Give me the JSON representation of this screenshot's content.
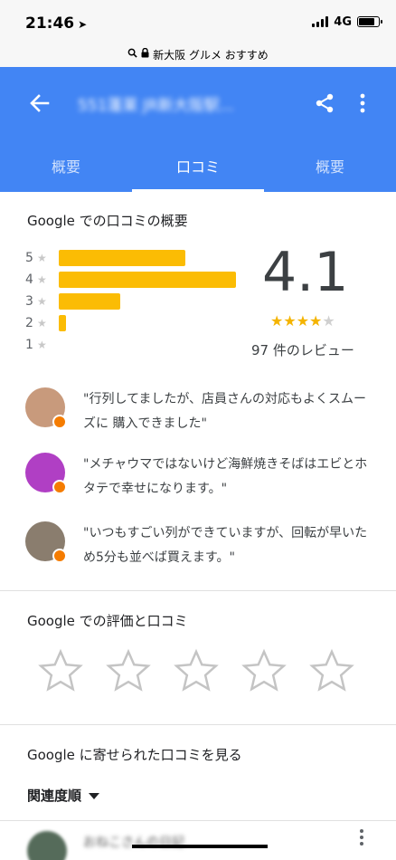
{
  "status_bar": {
    "time": "21:46",
    "network": "4G"
  },
  "url_bar": {
    "text": "新大阪 グルメ おすすめ"
  },
  "app_bar": {
    "title": "551蓬莱 JR新大阪駅..."
  },
  "tabs": [
    {
      "label": "概要"
    },
    {
      "label": "口コミ"
    },
    {
      "label": "概要"
    }
  ],
  "overview": {
    "title": "Google での口コミの概要",
    "rating": "4.1",
    "stars_filled": 4,
    "review_count_text": "97 件のレビュー",
    "distribution": [
      {
        "star": "5",
        "fraction": 0.7
      },
      {
        "star": "4",
        "fraction": 0.98
      },
      {
        "star": "3",
        "fraction": 0.34
      },
      {
        "star": "2",
        "fraction": 0.04
      },
      {
        "star": "1",
        "fraction": 0.0
      }
    ]
  },
  "snippets": [
    {
      "text": "\"行列してましたが、店員さんの対応もよくスムーズに 購入できました\"",
      "avatar_color": "#c89a7c"
    },
    {
      "text": "\"メチャウマではないけど海鮮焼きそばはエビとホタテで幸せになります。\"",
      "avatar_color": "#b03fc4"
    },
    {
      "text": "\"いつもすごい列ができていますが、回転が早いため5分も並べば買えます。\"",
      "avatar_color": "#8a7d6e"
    }
  ],
  "rate_section": {
    "title": "Google での評価と口コミ"
  },
  "reviews_section": {
    "title": "Google に寄せられた口コミを見る",
    "sort_label": "関連度順"
  },
  "first_review": {
    "name": "おねこさんの日記"
  },
  "colors": {
    "accent": "#4285f4",
    "bar": "#fbbc04",
    "star": "#f4b400"
  }
}
